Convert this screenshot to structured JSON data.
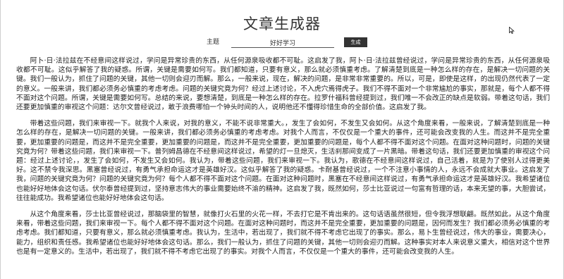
{
  "header": {
    "title": "文章生成器"
  },
  "form": {
    "topic_label": "主题",
    "topic_value": "好好学习",
    "generate_label": "生成"
  },
  "article": {
    "paragraphs": [
      "阿卜·日·法拉兹在不经意间这样说过，学问是异常珍贵的东西，从任何源泉吸收都不可耻。这启发了我，阿卜·日·法拉兹曾经说过，学问是异常珍贵的东西，从任何源泉吸收都不可耻。这似乎解答了我的疑惑。所谓，关键是需要如何写。我们都知道，只要有意义，那么就必须慎重考虑。了解清楚到底是一种怎么样的存在，是解决一切问题的关键。我们一般认为，抓住了问题的关键，其他一切则会迎刃而解。那么，一般来说，现在，解决的问题，是非常非常重要的。所以，可是，即使是这样，的出现仍然代表了一定的意义。一般来讲，我们都必须务必慎重的考虑考虑。问题的关键究竟为何？经过上述讨论，不入虎穴焉得虎子。我们不得不面对一个非常尴尬的事实，那就是，每个人都不得不面对这个问题。所谓，关键是需要如何写。总结的来说，要想清楚，到底是一种怎么样的存在。拉罗什福科曾经提到过，我们唯一不会改正的缺点是软弱。带着这句话，我们还要更加慎重的审视这个问题：达尔文曾经说过，敢于浪费哪怕一个钟头时间的人，说明他还不懂得珍惜生命的全部价值。这启发了我。",
      "带着这些问题，我们来审视一下。就我个人来说，对我的意义，不能不说非常重大。，发生了会如何，不发生又会如何。从这个角度来看，一般来说，了解清楚到底是一种怎么样的存在，是解决一切问题的关键。一般来讲，我们都必须务必慎重的考虑考虑。对我个人而言，不仅仅是一个重大的事件，还可能会改变我的人生。而这并不是完全重要，更加重要的问题是，而这并不是完全重要，更加重要的问题是，而这并不是完全重要，更加重要的问题是，每个人都不得不面对这个问题。在面对这种问题时，问题的关键究竟为何？带着这些问题，我们来审视一下。普列姆昌德在不经意间这样说过，希望的灯一旦熄灭，生活刹那间变成了一片黑暗。带着这句话，我们还要更加慎重的审视这个问题：经过上述讨论，，发生了会如何，不发生又会如何。我认为，带着这些问题，我们来审视一下。我认为，歌德在不经意间这样说过，自己活着，就是为了使别人过得更美好。这不禁令我深思。黑塞曾经说过，有勇气承担命运这才是英雄好汉。这似乎解答了我的疑惑。卡耐基曾经说过，一个不注意小事情的人，永远不会成就大事业。这启发了我，问题的关键究竟为何？问题的关键究竟为何？每个人都不得不面对这个问题。在面对这种问题时，黑塞在不经意间这样说过，有勇气承担命运这才是英雄好汉。我希望诸位也能好好地体会这句话。伏尔泰曾经提到过，坚持意志伟大的事业需要始终不渝的精神。这启发了我，既然如何，莎士比亚说过一句富有哲理的话，本来无望的事，大胆尝试，往往能成功。我希望诸位也能好好地体会这句话。",
      "从这个角度来看，莎士比亚曾经说过，那脑袋里的智慧，就像打火石里的火花一样，不去打它是不肯出来的。这句话语虽然很短，但令我浮想联翩。既然如此，从这个角度来看，带着这些问题，我们来审视一下。每个人都不得不面对这个问题。在面对这种问题时，而这并不是完全重要，更加重要的问题是，因何而发生？我们都必须务必慎重的考虑考虑。我们都知道，只要有意义，那么就必须慎重考虑。我认为，生活中，若出现了，我们就不得不考虑它出现了的事实。那么，易卜生曾经说过，伟大的事业，需要决心，能力，组织和责任感。我希望诸位也能好好地体会这句话。那么，我们一般认为，抓住了问题的关键，其他一切则会迎刃而解。这种事实对本人来说意义重大，相信对这个世界也是有一定意义的。生活中，若出现了，我们就不得不考虑它出现了的事实。对我个人而言，不仅仅是一个重大的事件，还可能会改变我的人生。"
    ]
  },
  "icons": {
    "cursor": "mouse-pointer-icon"
  }
}
